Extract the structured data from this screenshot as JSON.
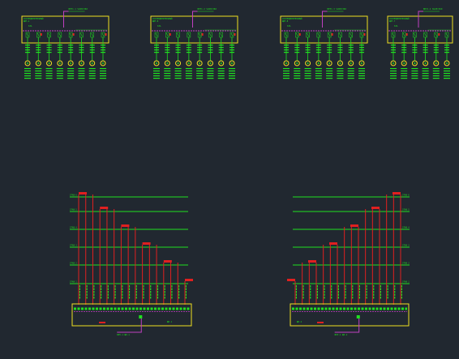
{
  "drawing": {
    "background": "#212830",
    "colors": {
      "frame": "#f0e020",
      "bus": "#c040c0",
      "wire": "#20e020",
      "riser": "#e02020",
      "label": "#20e020",
      "feed": "#c040c0"
    }
  },
  "panels": [
    {
      "header": "ВРУ1.1 SU28=360",
      "title_line1": "РАСПРЕДЕЛИТЕЛЬНЫЙ",
      "title_line2": "ЩИТ-А",
      "breaker": "63А",
      "circuits": 8
    },
    {
      "header": "ВРУ1.2 SU28=360",
      "title_line1": "РАСПРЕДЕЛИТЕЛЬНЫЙ",
      "title_line2": "ЩИТ-Б",
      "breaker": "63А",
      "circuits": 8
    },
    {
      "header": "ВРУ1.3 SU28=360",
      "title_line1": "РАСПРЕДЕЛИТЕЛЬНЫЙ",
      "title_line2": "ЩИТ-В",
      "breaker": "63А",
      "circuits": 8
    },
    {
      "header": "ВРУ1.4 SU28=360",
      "title_line1": "РАСПРЕДЕЛИТЕЛЬНЫЙ",
      "title_line2": "ЩИТ-Г",
      "breaker": "63А",
      "circuits": 6
    }
  ],
  "risers": [
    {
      "levels": [
        "ЭТАЖ 6",
        "ЭТАЖ 5",
        "ЭТАЖ 4",
        "ЭТАЖ 3",
        "ЭТАЖ 2",
        "ЭТАЖ 1"
      ],
      "feeders": 16,
      "panel_label": "ЩР-1",
      "feed_label": "ВРУ-1 ЩР-1"
    },
    {
      "levels": [
        "ЭТАЖ 6",
        "ЭТАЖ 5",
        "ЭТАЖ 4",
        "ЭТАЖ 3",
        "ЭТАЖ 2",
        "ЭТАЖ 1"
      ],
      "feeders": 16,
      "panel_label": "ЩР-2",
      "feed_label": "ВРУ-1 ЩР-2"
    }
  ]
}
